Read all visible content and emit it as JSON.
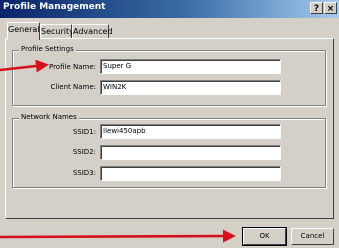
{
  "window": {
    "title": "Profile Management",
    "help_glyph": "?",
    "close_glyph": "×"
  },
  "tabs": [
    {
      "label": "General",
      "active": true
    },
    {
      "label": "Security",
      "active": false
    },
    {
      "label": "Advanced",
      "active": false
    }
  ],
  "profile_settings": {
    "legend": "Profile Settings",
    "profile_name_label": "Profile Name:",
    "profile_name_value": "Super G",
    "client_name_label": "Client Name:",
    "client_name_value": "WIN2K"
  },
  "network_names": {
    "legend": "Network Names",
    "ssid1_label": "SSID1:",
    "ssid1_value": "Ilewi450apb",
    "ssid2_label": "SSID2:",
    "ssid2_value": "",
    "ssid3_label": "SSID3:",
    "ssid3_value": ""
  },
  "buttons": {
    "ok": "OK",
    "cancel": "Cancel"
  },
  "annotation": {
    "arrow_color": "#d4101a"
  }
}
